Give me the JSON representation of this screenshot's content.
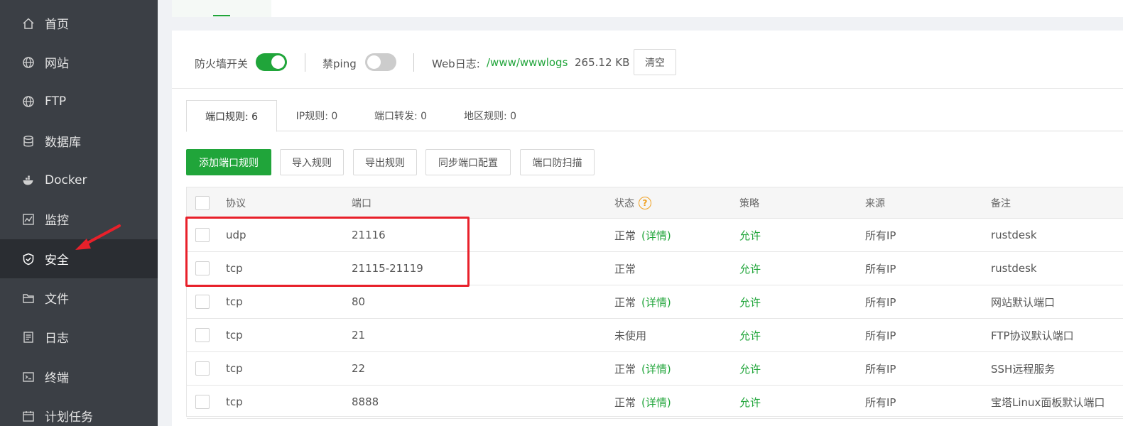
{
  "sidebar": {
    "items": [
      {
        "label": "首页",
        "icon": "home-icon"
      },
      {
        "label": "网站",
        "icon": "globe-icon"
      },
      {
        "label": "FTP",
        "icon": "ftp-globe-icon"
      },
      {
        "label": "数据库",
        "icon": "database-icon"
      },
      {
        "label": "Docker",
        "icon": "docker-icon"
      },
      {
        "label": "监控",
        "icon": "monitor-icon"
      },
      {
        "label": "安全",
        "icon": "shield-icon",
        "active": true
      },
      {
        "label": "文件",
        "icon": "folder-icon"
      },
      {
        "label": "日志",
        "icon": "log-icon"
      },
      {
        "label": "终端",
        "icon": "terminal-icon"
      },
      {
        "label": "计划任务",
        "icon": "calendar-icon"
      }
    ]
  },
  "toolbar": {
    "firewall_label": "防火墙开关",
    "firewall_on": true,
    "ping_label": "禁ping",
    "ping_on": false,
    "weblog_label": "Web日志:",
    "weblog_path": "/www/wwwlogs",
    "weblog_size": "265.12 KB",
    "clear_label": "清空"
  },
  "tabs": [
    {
      "label": "端口规则: 6",
      "active": true
    },
    {
      "label": "IP规则: 0"
    },
    {
      "label": "端口转发: 0"
    },
    {
      "label": "地区规则: 0"
    }
  ],
  "actions": {
    "add_port_rule": "添加端口规则",
    "import_rules": "导入规则",
    "export_rules": "导出规则",
    "sync_port_config": "同步端口配置",
    "port_anti_scan": "端口防扫描"
  },
  "table": {
    "headers": {
      "protocol": "协议",
      "port": "端口",
      "status": "状态",
      "policy": "策略",
      "source": "来源",
      "remark": "备注"
    },
    "detail_label": "(详情)",
    "rows": [
      {
        "protocol": "udp",
        "port": "21116",
        "status": "正常",
        "has_detail": true,
        "policy": "允许",
        "source": "所有IP",
        "remark": "rustdesk"
      },
      {
        "protocol": "tcp",
        "port": "21115-21119",
        "status": "正常",
        "has_detail": false,
        "policy": "允许",
        "source": "所有IP",
        "remark": "rustdesk"
      },
      {
        "protocol": "tcp",
        "port": "80",
        "status": "正常",
        "has_detail": true,
        "policy": "允许",
        "source": "所有IP",
        "remark": "网站默认端口"
      },
      {
        "protocol": "tcp",
        "port": "21",
        "status": "未使用",
        "has_detail": false,
        "policy": "允许",
        "source": "所有IP",
        "remark": "FTP协议默认端口"
      },
      {
        "protocol": "tcp",
        "port": "22",
        "status": "正常",
        "has_detail": true,
        "policy": "允许",
        "source": "所有IP",
        "remark": "SSH远程服务"
      },
      {
        "protocol": "tcp",
        "port": "8888",
        "status": "正常",
        "has_detail": true,
        "policy": "允许",
        "source": "所有IP",
        "remark": "宝塔Linux面板默认端口"
      }
    ]
  },
  "colors": {
    "accent": "#20a53a",
    "sidebar_bg": "#3b3f45",
    "sidebar_active": "#2a2d32",
    "annotation": "#e8202a",
    "help": "#f0a020"
  }
}
